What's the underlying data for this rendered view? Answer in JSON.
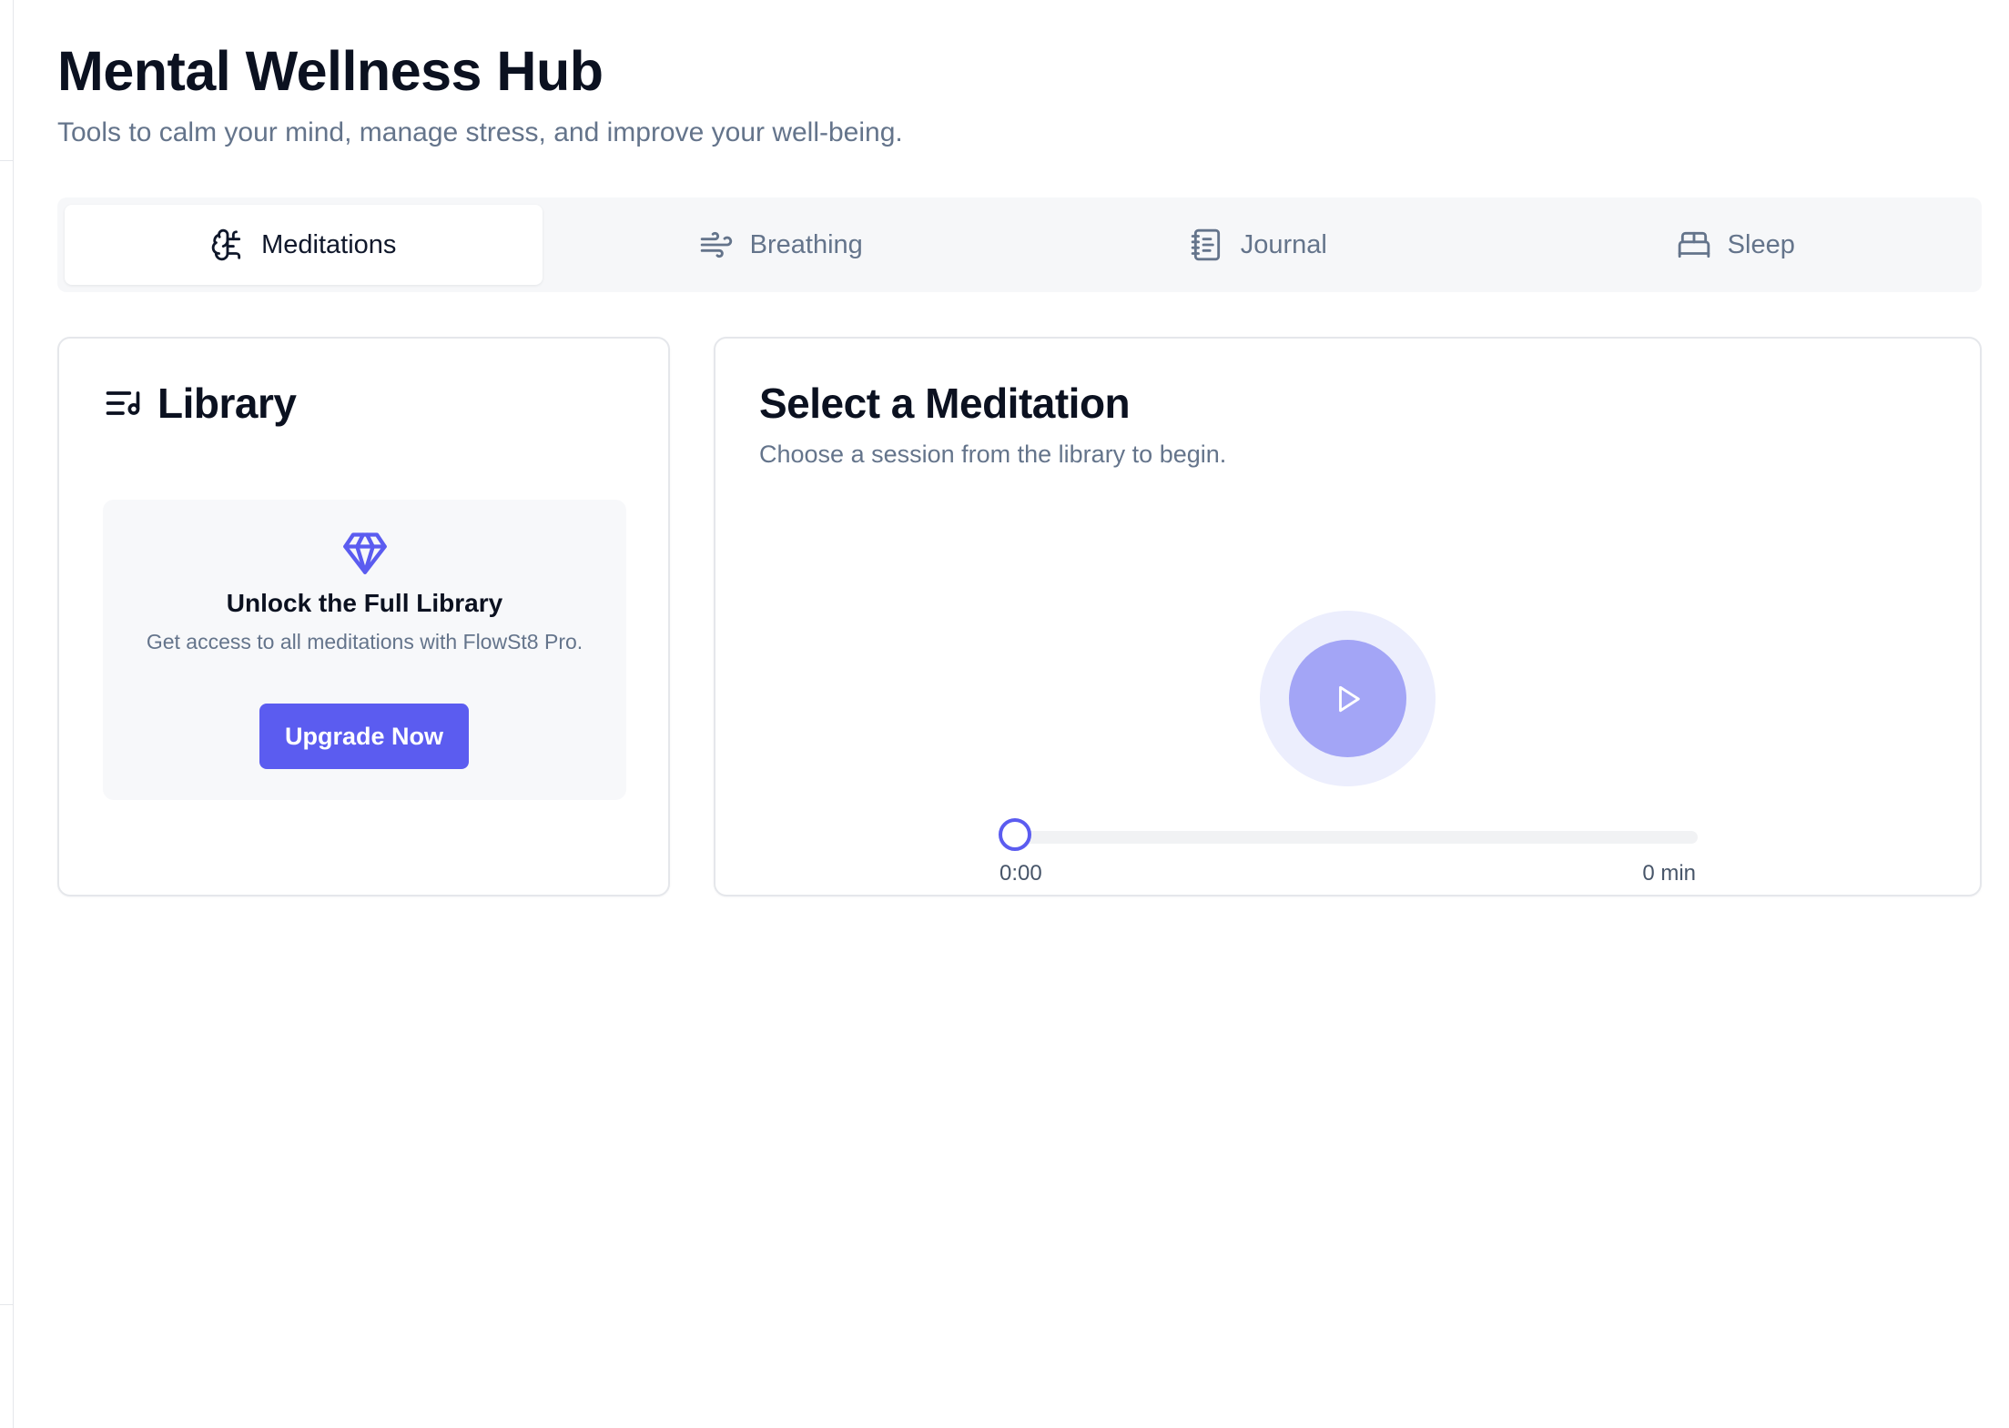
{
  "header": {
    "title": "Mental Wellness Hub",
    "subtitle": "Tools to calm your mind, manage stress, and improve your well-being."
  },
  "tabs": [
    {
      "label": "Meditations",
      "icon": "brain-icon",
      "active": true
    },
    {
      "label": "Breathing",
      "icon": "wind-icon",
      "active": false
    },
    {
      "label": "Journal",
      "icon": "notebook-icon",
      "active": false
    },
    {
      "label": "Sleep",
      "icon": "bed-icon",
      "active": false
    }
  ],
  "library": {
    "title": "Library",
    "icon": "list-music-icon",
    "upsell": {
      "icon": "gem-icon",
      "title": "Unlock the Full Library",
      "text": "Get access to all meditations with FlowSt8 Pro.",
      "button_label": "Upgrade Now"
    }
  },
  "player": {
    "title": "Select a Meditation",
    "subtitle": "Choose a session from the library to begin.",
    "progress": 0,
    "current_time": "0:00",
    "duration": "0 min"
  },
  "colors": {
    "accent": "#5b5cf0",
    "play_button": "#a3a5f6",
    "play_halo": "#eceefd",
    "muted_text": "#64748b"
  }
}
